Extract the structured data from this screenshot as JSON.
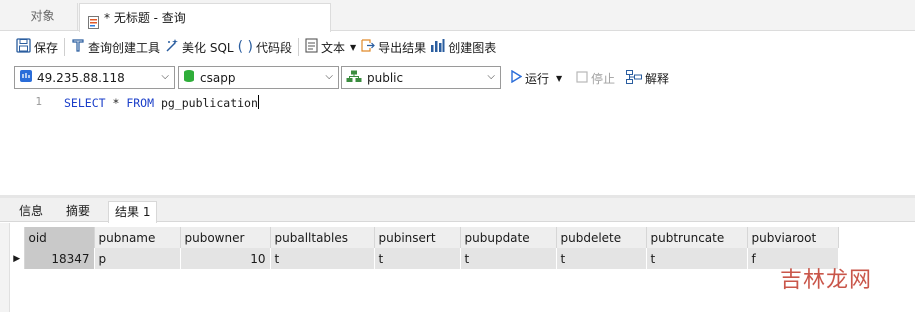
{
  "tabs": {
    "objects_label": "对象",
    "query_label": "* 无标题 - 查询"
  },
  "toolbar": {
    "save": "保存",
    "query_builder": "查询创建工具",
    "beautify_sql": "美化 SQL",
    "code_snippet": "代码段",
    "text": "文本",
    "export_result": "导出结果",
    "create_chart": "创建图表"
  },
  "connection": {
    "host": "49.235.88.118",
    "database": "csapp",
    "schema": "public",
    "run": "运行",
    "stop": "停止",
    "explain": "解释"
  },
  "editor": {
    "line_number": "1",
    "kw_select": "SELECT",
    "star": " * ",
    "kw_from": "FROM",
    "table_name": " pg_publication"
  },
  "result_tabs": {
    "info": "信息",
    "summary": "摘要",
    "result1": "结果 1"
  },
  "grid": {
    "columns": [
      "oid",
      "pubname",
      "pubowner",
      "puballtables",
      "pubinsert",
      "pubupdate",
      "pubdelete",
      "pubtruncate",
      "pubviaroot"
    ],
    "row": [
      "18347",
      "p",
      "10",
      "t",
      "t",
      "t",
      "t",
      "t",
      "f"
    ]
  },
  "watermark": "吉林龙网",
  "colors": {
    "keyword": "#1a3ec9",
    "selected_cell": "#c9c9c9",
    "row_bg": "#e4e4e4"
  }
}
